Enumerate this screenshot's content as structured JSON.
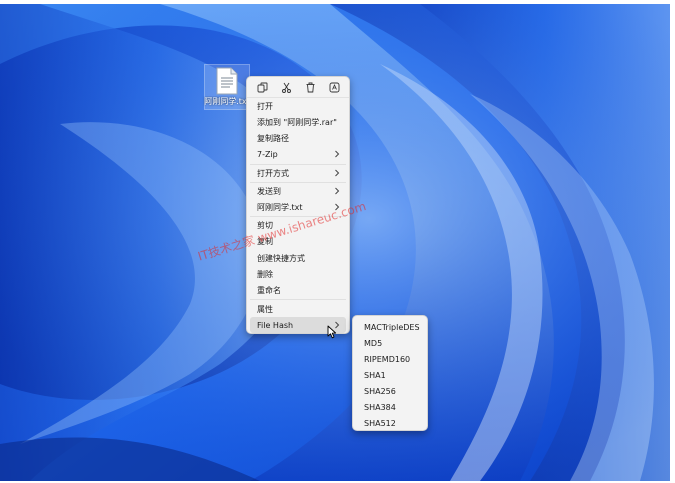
{
  "desktop": {
    "file_label": "阿刚同学.txt"
  },
  "context_menu": {
    "toolbar": [
      {
        "name": "copy-icon"
      },
      {
        "name": "cut-icon"
      },
      {
        "name": "delete-icon"
      },
      {
        "name": "rename-icon"
      }
    ],
    "items": [
      {
        "label": "打开",
        "submenu": false
      },
      {
        "label": "添加到 \"阿刚同学.rar\"",
        "submenu": false
      },
      {
        "label": "复制路径",
        "submenu": false
      },
      {
        "label": "7-Zip",
        "submenu": true
      },
      {
        "label": "打开方式",
        "submenu": true
      },
      {
        "label": "发送到",
        "submenu": true
      },
      {
        "label": "阿刚同学.txt",
        "submenu": true
      },
      {
        "label": "剪切",
        "submenu": false
      },
      {
        "label": "复制",
        "submenu": false
      },
      {
        "label": "创建快捷方式",
        "submenu": false
      },
      {
        "label": "删除",
        "submenu": false
      },
      {
        "label": "重命名",
        "submenu": false
      },
      {
        "label": "属性",
        "submenu": false
      },
      {
        "label": "File Hash",
        "submenu": true,
        "highlighted": true
      }
    ]
  },
  "file_hash_submenu": {
    "items": [
      "MACTripleDES",
      "MD5",
      "RIPEMD160",
      "SHA1",
      "SHA256",
      "SHA384",
      "SHA512"
    ]
  },
  "watermark": {
    "text": "IT技术之家 www.ishareuc.com"
  },
  "colors": {
    "wallpaper_base": "#1a5de6",
    "menu_background": "#f3f3f3",
    "highlight": "#dcdcdc"
  }
}
